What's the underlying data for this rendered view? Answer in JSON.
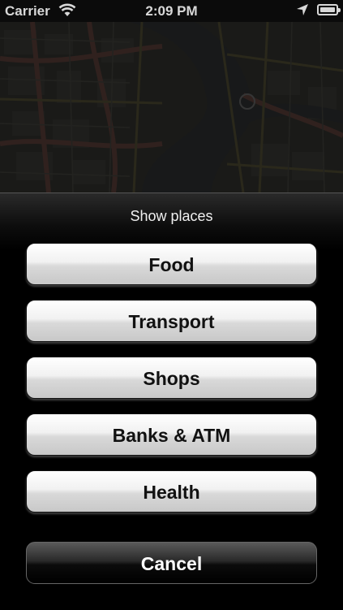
{
  "status_bar": {
    "carrier": "Carrier",
    "time": "2:09 PM"
  },
  "action_sheet": {
    "title": "Show places",
    "options": [
      {
        "label": "Food"
      },
      {
        "label": "Transport"
      },
      {
        "label": "Shops"
      },
      {
        "label": "Banks & ATM"
      },
      {
        "label": "Health"
      }
    ],
    "cancel_label": "Cancel"
  }
}
